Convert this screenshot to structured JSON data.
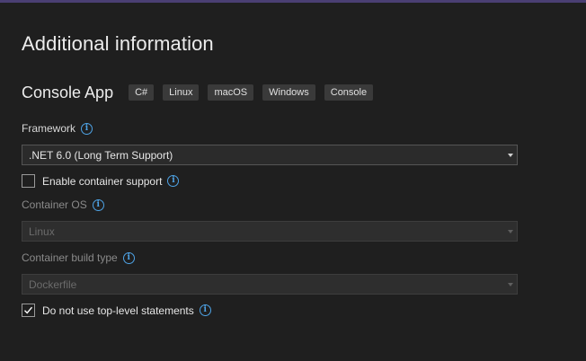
{
  "dialog": {
    "title": "Additional information"
  },
  "template": {
    "name": "Console App",
    "tags": [
      "C#",
      "Linux",
      "macOS",
      "Windows",
      "Console"
    ]
  },
  "framework": {
    "label": "Framework",
    "value": ".NET 6.0 (Long Term Support)"
  },
  "container_support": {
    "label": "Enable container support",
    "checked": false
  },
  "container_os": {
    "label": "Container OS",
    "value": "Linux",
    "enabled": false
  },
  "container_build_type": {
    "label": "Container build type",
    "value": "Dockerfile",
    "enabled": false
  },
  "top_level_statements": {
    "label": "Do not use top-level statements",
    "checked": true
  },
  "icons": {
    "info": "info-circle-icon",
    "dropdown": "chevron-down-icon",
    "check": "checkmark-icon"
  },
  "colors": {
    "background": "#1f1f1f",
    "accent_info": "#4ea3e6",
    "tag_bg": "#3a3a3a"
  }
}
